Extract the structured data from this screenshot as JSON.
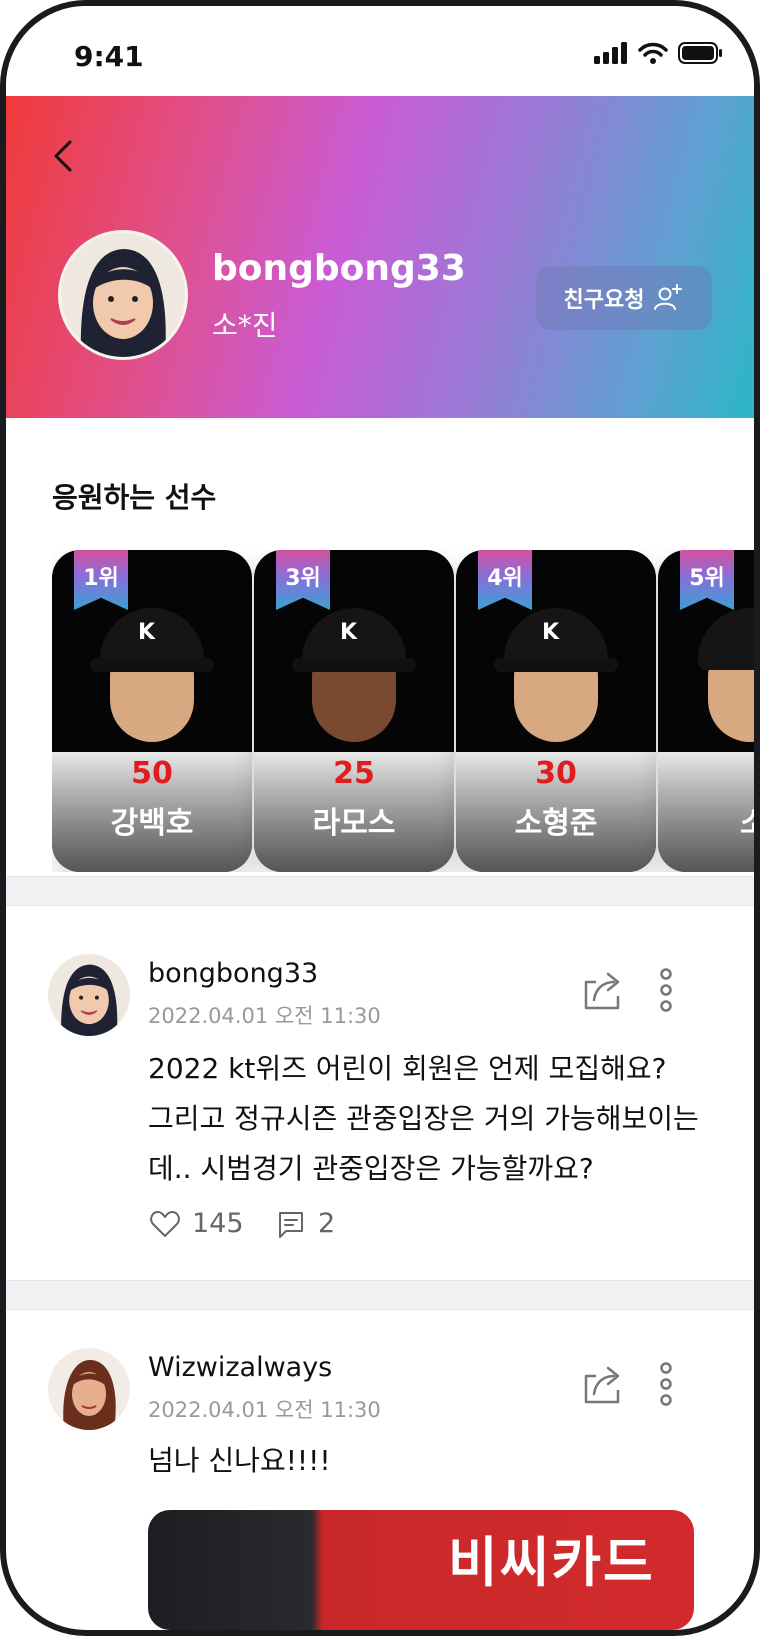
{
  "status_bar": {
    "time": "9:41"
  },
  "profile": {
    "username": "bongbong33",
    "real_name": "소*진",
    "friend_button": "친구요청"
  },
  "favorites": {
    "title": "응원하는 선수",
    "players": [
      {
        "rank": "1위",
        "number": "50",
        "name": "강백호"
      },
      {
        "rank": "3위",
        "number": "25",
        "name": "라모스"
      },
      {
        "rank": "4위",
        "number": "30",
        "name": "소형준"
      },
      {
        "rank": "5위",
        "number": "",
        "name": "소"
      }
    ]
  },
  "posts": [
    {
      "author": "bongbong33",
      "date": "2022.04.01 오전 11:30",
      "lines": [
        "2022 kt위즈 어린이 회원은 언제 모집해요?",
        "그리고 정규시즌 관중입장은 거의 가능해보이는",
        "데.. 시범경기 관중입장은 가능할까요?"
      ],
      "likes": "145",
      "comments": "2"
    },
    {
      "author": "Wizwizalways",
      "date": "2022.04.01 오전 11:30",
      "lines": [
        "넘나 신나요!!!!"
      ],
      "image_text": "비씨카드"
    }
  ],
  "colors": {
    "header_start": "#f03a3a",
    "header_mid": "#c85cd6",
    "header_end": "#2bb7c6",
    "jersey_number": "#e21c1c"
  },
  "icons": [
    "back-icon",
    "add-friend-icon",
    "share-icon",
    "more-icon",
    "heart-icon",
    "comment-icon",
    "signal-icon",
    "wifi-icon",
    "battery-icon"
  ]
}
